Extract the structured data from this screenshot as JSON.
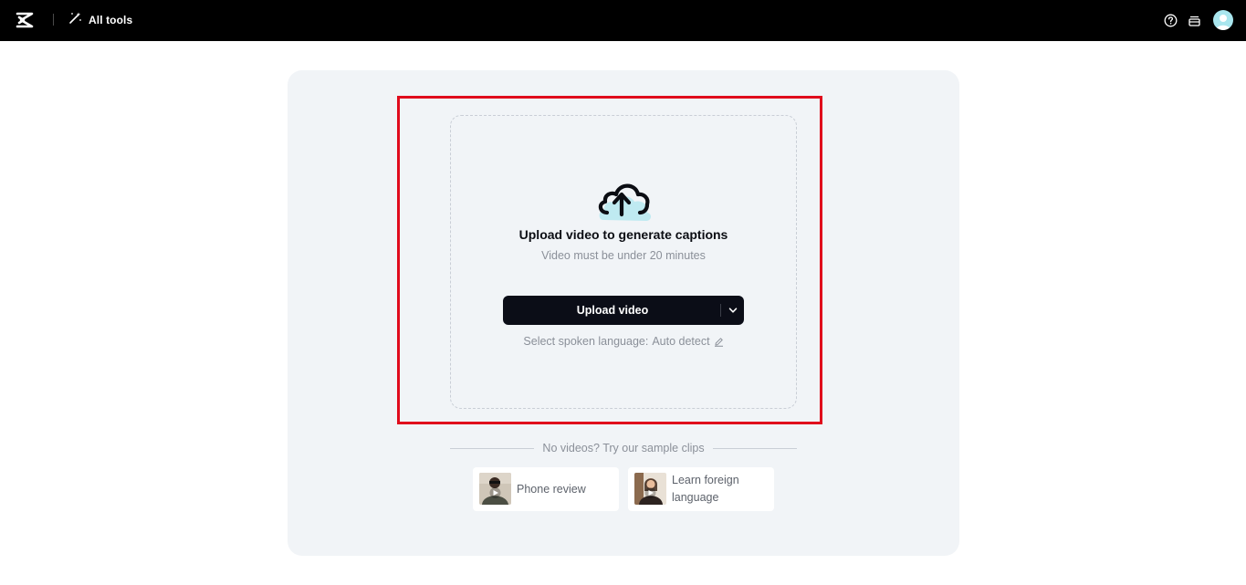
{
  "header": {
    "all_tools_label": "All tools",
    "icons": [
      "logo-icon",
      "magic-wand-icon",
      "help-icon",
      "inbox-icon",
      "avatar"
    ]
  },
  "upload": {
    "title": "Upload video to generate captions",
    "subtitle": "Video must be under 20 minutes",
    "button_label": "Upload video",
    "language_prefix": "Select spoken language:",
    "language_value": "Auto detect"
  },
  "samples": {
    "separator_text": "No videos? Try our sample clips",
    "items": [
      {
        "label": "Phone review"
      },
      {
        "label": "Learn foreign language"
      }
    ]
  },
  "colors": {
    "topbar": "#000000",
    "panel": "#f1f4f7",
    "button": "#0b0d17",
    "highlight": "#e00b1c",
    "cloud_accent": "#bfeaf1"
  }
}
